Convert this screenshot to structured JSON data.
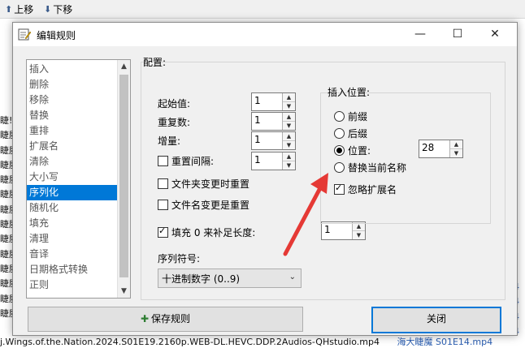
{
  "app": {
    "toolbar": {
      "move_up": "上移",
      "move_down": "下移"
    },
    "side_rows": [
      "睫!",
      "睫魔",
      "睫魔",
      "睫魔",
      "睫魔",
      "睫魔",
      "睫魔",
      "睫魔",
      "睫魔",
      "睫魔",
      "睫魔",
      "睫魔",
      "睫魔",
      "睫魔"
    ],
    "right_rows": [
      "4",
      "4",
      "4",
      "4"
    ],
    "bottom_file": "j.Wings.of.the.Nation.2024.S01E19.2160p.WEB-DL.HEVC.DDP.2Audios-QHstudio.mp4",
    "bottom_sub": "海大睫魔 S01E14.mp4"
  },
  "dialog": {
    "title": "编辑规则",
    "controls": {
      "minimize": "—",
      "maximize": "☐",
      "close": "✕"
    },
    "rule_list": [
      "插入",
      "删除",
      "移除",
      "替换",
      "重排",
      "扩展名",
      "清除",
      "大小写",
      "序列化",
      "随机化",
      "填充",
      "清理",
      "音译",
      "日期格式转换",
      "正则"
    ],
    "selected_index": 8,
    "config": {
      "label": "配置:",
      "start_label": "起始值:",
      "start_value": "1",
      "repeat_label": "重复数:",
      "repeat_value": "1",
      "step_label": "增量:",
      "step_value": "1",
      "reset_label": "重置间隔:",
      "reset_value": "1",
      "reset_checked": false,
      "folder_reset_label": "文件夹变更时重置",
      "folder_reset_checked": false,
      "name_reset_label": "文件名变更是重置",
      "name_reset_checked": false,
      "pad_label": "填充 0 来补足长度:",
      "pad_checked": true,
      "pad_value": "1",
      "seq_symbol_label": "序列符号:",
      "seq_symbol_value": "十进制数字 (0..9)"
    },
    "insert": {
      "title": "插入位置:",
      "options": [
        "前缀",
        "后缀",
        "位置:",
        "替换当前名称"
      ],
      "selected_index": 2,
      "position_value": "28",
      "ignore_ext_label": "忽略扩展名",
      "ignore_ext_checked": true
    },
    "buttons": {
      "save": "保存规则",
      "close": "关闭"
    }
  },
  "annotation": {
    "arrow_color": "#e53935"
  },
  "colors": {
    "selection": "#0078d7",
    "dialog_bg": "#f0f0f0"
  }
}
